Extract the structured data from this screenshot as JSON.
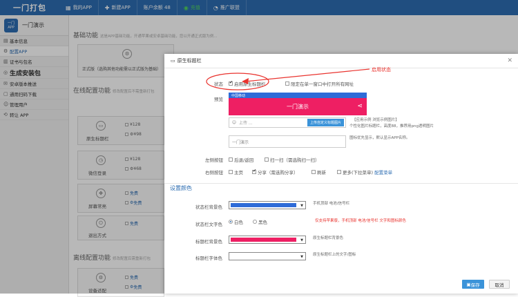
{
  "topbar": {
    "logo": "一门打包",
    "nav": [
      {
        "icon": "▦",
        "label": "我的APP"
      },
      {
        "icon": "✚",
        "label": "新建APP"
      },
      {
        "icon": "",
        "label": "账户余额 48"
      },
      {
        "icon": "",
        "label": "充值"
      },
      {
        "icon": "◔",
        "label": "推广联盟"
      }
    ]
  },
  "sidebar": {
    "app_icon_text": "一门 APP",
    "app_name": "一门演示",
    "items": [
      {
        "icon": "▤",
        "label": "基本信息"
      },
      {
        "icon": "⚙",
        "label": "配置APP"
      },
      {
        "icon": "▥",
        "label": "证书与包名"
      },
      {
        "icon": "◎",
        "label": "生成安装包"
      },
      {
        "icon": "✉",
        "label": "安卓版本推送"
      },
      {
        "icon": "▢",
        "label": "通用扫码下载"
      },
      {
        "icon": "☺",
        "label": "管理用户"
      },
      {
        "icon": "⟲",
        "label": "转让 APP"
      }
    ]
  },
  "page": {
    "section_basic": "基础功能",
    "section_basic_hint": "这是APP基础功能，开通苹果或安卓基础功能，您以开通正式版为例...",
    "basic_card": "正式版（选购其他功能需以正式版为基础）",
    "section_online": "在线配置功能",
    "section_online_hint": "修改配置后不需重新打包",
    "section_offline": "离线配置功能",
    "section_offline_hint": "修改配置后需重新打包",
    "cards": [
      {
        "icon": "▭",
        "label": "原生标题栏",
        "p1": "¥128",
        "p2": "¥98"
      },
      {
        "icon": "◷",
        "label": "微信登录",
        "p1": "¥128",
        "p2": "¥68"
      },
      {
        "icon": "✥",
        "label": "屏幕常亮",
        "p1": "免费",
        "p2": "免费"
      },
      {
        "icon": "⏻",
        "label": "退出方式",
        "p1": "免费",
        "p2": ""
      },
      {
        "icon": "⚙",
        "label": "设备适配",
        "p1": "免费",
        "p2": "免费"
      }
    ]
  },
  "modal": {
    "title": "原生标题栏",
    "status_label": "状态",
    "status_enable": "启用原生标题栏",
    "status_single": "限定在单一窗口中打开所有网址",
    "preview_label": "预览",
    "preview_status": "中国移动",
    "preview_title": "一门演示",
    "upload_placeholder": "上传 ...",
    "upload_button": "上传自定义标题图片",
    "example_links": "【应用示例  浏览示例图片】",
    "image_hint": "个性化图片标题栏，高度88，推荐用png透明图片",
    "title_input": "一门演示",
    "title_hint": "图标优先显示，默认显示APP名称。",
    "left_label": "左侧按钮",
    "left_opts": [
      "后退/返回",
      "扫一扫（需选购扫一扫）"
    ],
    "right_label": "右侧按钮",
    "right_opts": [
      "主页",
      "分享（需选购分享）",
      "刷新",
      "更多(下拉菜单)"
    ],
    "config_menu": "配置菜单",
    "color_section": "设置颜色",
    "status_bg_label": "状态栏背景色",
    "status_bg_hint": "手机顶部 电池/信号栏",
    "status_text_label": "状态栏文字色",
    "status_text_opts": [
      "白色",
      "黑色"
    ],
    "status_text_hint": "仅支持苹果版，手机顶部 电池/信号栏 文字和图标颜色",
    "title_bg_label": "标题栏背景色",
    "title_bg_hint": "原生标题栏背景色",
    "title_text_label": "标题栏字体色",
    "title_text_hint": "原生标题栏上的文字/图标",
    "save": "保存",
    "cancel": "取消",
    "colors": {
      "status_bg": "#2e6bd8",
      "title_bg": "#ee1f63",
      "title_text": "#ffffff"
    }
  },
  "annotation": "启用状态"
}
